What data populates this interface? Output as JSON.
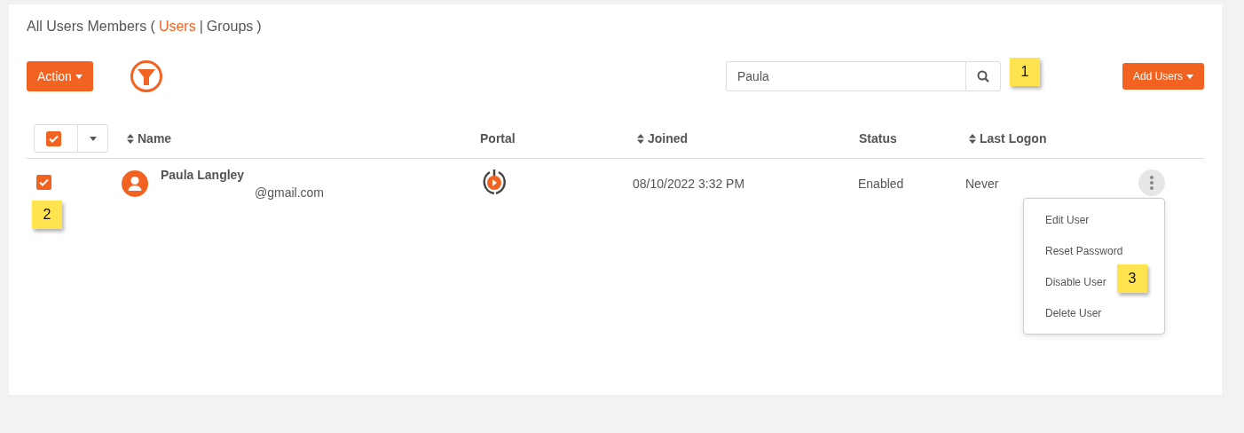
{
  "header": {
    "title_prefix": "All Users Members (",
    "tabs": [
      {
        "label": "Users",
        "selected": true
      },
      {
        "label": "Groups",
        "selected": false
      }
    ],
    "separator": "|",
    "title_suffix": ")"
  },
  "toolbar": {
    "action_button": "Action",
    "search": {
      "value": "Paula"
    },
    "add_button": "Add Users"
  },
  "table": {
    "select_all": {
      "checked": true
    },
    "columns": [
      {
        "label": "Name",
        "sortable": true
      },
      {
        "label": "Portal",
        "sortable": false
      },
      {
        "label": "Joined",
        "sortable": true
      },
      {
        "label": "Status",
        "sortable": false
      },
      {
        "label": "Last Logon",
        "sortable": true
      }
    ],
    "rows": [
      {
        "checked": true,
        "name": "Paula Langley",
        "email": "@gmail.com",
        "joined": "08/10/2022 3:32 PM",
        "status": "Enabled",
        "last_logon": "Never",
        "menu_open": true
      }
    ]
  },
  "row_menu": {
    "items": [
      "Edit User",
      "Reset Password",
      "Disable User",
      "Delete User"
    ]
  },
  "callouts": [
    {
      "label": "1"
    },
    {
      "label": "2"
    },
    {
      "label": "3"
    }
  ]
}
